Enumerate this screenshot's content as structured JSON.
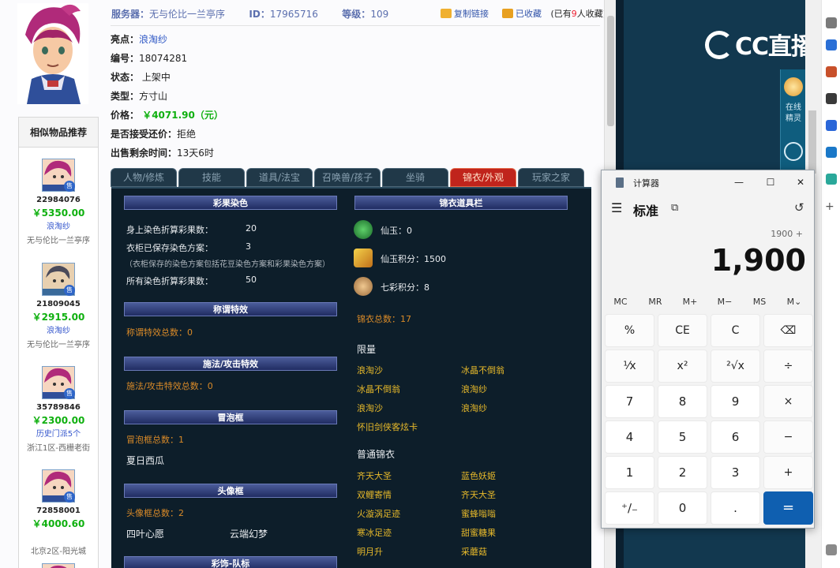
{
  "header": {
    "server_label": "服务器：",
    "server_value": "无与伦比一兰亭序",
    "id_label": "ID：",
    "id_value": "17965716",
    "level_label": "等级：",
    "level_value": "109",
    "copy_link": "复制链接",
    "favorited": "已收藏",
    "fav_count_prefix": "(已有",
    "fav_count_value": "9",
    "fav_count_suffix": "人收藏)"
  },
  "props": [
    {
      "k": "亮点：",
      "v": "浪淘纱",
      "style": "link"
    },
    {
      "k": "编号：",
      "v": "18074281",
      "style": ""
    },
    {
      "k": "状态：",
      "v": " 上架中",
      "style": ""
    },
    {
      "k": "类型：",
      "v": "方寸山",
      "style": ""
    },
    {
      "k": "价格：",
      "v": " ￥4071.90（元）",
      "style": "price"
    },
    {
      "k": "是否接受还价：",
      "v": "拒绝",
      "style": ""
    },
    {
      "k": "出售剩余时间：",
      "v": "13天6时",
      "style": ""
    }
  ],
  "similar": {
    "title": "相似物品推荐",
    "items": [
      {
        "id": "22984076",
        "price": "￥5350.00",
        "name": "浪淘纱",
        "server": "无与伦比一兰亭序"
      },
      {
        "id": "21809045",
        "price": "￥2915.00",
        "name": "浪淘纱",
        "server": "无与伦比一兰亭序"
      },
      {
        "id": "35789846",
        "price": "￥2300.00",
        "name": "历史门派5个",
        "server": "浙江1区-西栅老街"
      },
      {
        "id": "72858001",
        "price": "￥4000.60",
        "name": "",
        "server": "北京2区-阳光城"
      }
    ],
    "badge": "售"
  },
  "tabs": [
    "人物/修炼",
    "技能",
    "道具/法宝",
    "召唤兽/孩子",
    "坐骑",
    "锦衣/外观",
    "玩家之家"
  ],
  "panel": {
    "left": {
      "dye_title": "彩果染色",
      "dye_rows": [
        {
          "k": "身上染色折算彩果数：",
          "v": "20"
        },
        {
          "k": "衣柜已保存染色方案：",
          "v": "3"
        },
        {
          "k": "所有染色折算彩果数：",
          "v": "50"
        }
      ],
      "dye_note": "（衣柜保存的染色方案包括花豆染色方案和彩果染色方案）",
      "title_effect": "称谓特效",
      "title_effect_count": "称谓特效总数：0",
      "spell_effect": "施法/攻击特效",
      "spell_effect_count": "施法/攻击特效总数：0",
      "bubble": "冒泡框",
      "bubble_count": "冒泡框总数：1",
      "bubble_item": "夏日西瓜",
      "avatar_frame": "头像框",
      "avatar_frame_count": "头像框总数：2",
      "avatar_frame_items": [
        "四叶心愿",
        "云端幻梦"
      ],
      "team_mark": "彩饰-队标"
    },
    "right": {
      "title": "锦衣道具栏",
      "items": [
        {
          "label": "仙玉：0",
          "icon": "jade-icon"
        },
        {
          "label": "仙玉积分：1500",
          "icon": "jade-points-icon"
        },
        {
          "label": "七彩积分：8",
          "icon": "rainbow-points-icon"
        }
      ],
      "total": "锦衣总数：17",
      "limited_title": "限量",
      "limited": [
        [
          "浪淘沙",
          "冰晶不倒翁"
        ],
        [
          "冰晶不倒翁",
          "浪淘纱"
        ],
        [
          "浪淘沙",
          "浪淘纱"
        ],
        [
          "怀旧剑侠客炫卡",
          ""
        ]
      ],
      "normal_title": "普通锦衣",
      "normal": [
        [
          "齐天大圣",
          "蓝色妖姬"
        ],
        [
          "双鲤寄情",
          "齐天大圣"
        ],
        [
          "火漩涡足迹",
          "蜜蜂嗡嗡"
        ],
        [
          "寒冰足迹",
          "甜蜜糖果"
        ],
        [
          "明月升",
          "采蘑菇"
        ]
      ]
    }
  },
  "right_bg": {
    "logo": "CC直播",
    "side_label_1": "在线精灵"
  },
  "calculator": {
    "title": "计算器",
    "mode": "标准",
    "expression": "1900 +",
    "display": "1,900",
    "memory": [
      "MC",
      "MR",
      "M+",
      "M−",
      "MS",
      "M⌄"
    ],
    "keys": [
      [
        "%",
        "CE",
        "C",
        "⌫"
      ],
      [
        "¹⁄x",
        "x²",
        "²√x",
        "÷"
      ],
      [
        "7",
        "8",
        "9",
        "×"
      ],
      [
        "4",
        "5",
        "6",
        "−"
      ],
      [
        "1",
        "2",
        "3",
        "+"
      ],
      [
        "⁺∕₋",
        "0",
        ".",
        "="
      ]
    ]
  }
}
